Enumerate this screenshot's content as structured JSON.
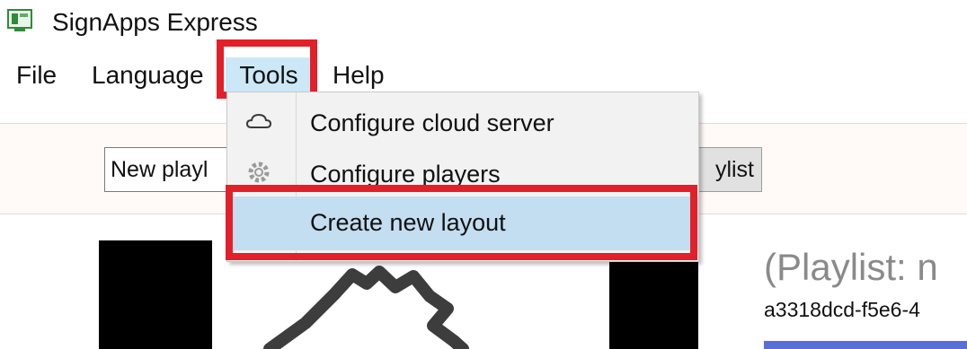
{
  "window": {
    "title": "SignApps Express",
    "icon": "signapps-app-icon"
  },
  "menubar": {
    "items": [
      {
        "label": "File"
      },
      {
        "label": "Language"
      },
      {
        "label": "Tools",
        "state": "open"
      },
      {
        "label": "Help"
      }
    ]
  },
  "tools_menu": {
    "items": [
      {
        "label": "Configure cloud server",
        "icon": "cloud-icon"
      },
      {
        "label": "Configure players",
        "icon": "gear-icon"
      },
      {
        "label": "Create new layout",
        "state": "highlighted"
      }
    ]
  },
  "toolbar": {
    "playlist_field_value": "New playl",
    "playlist_button_label": "ylist"
  },
  "main": {
    "playlist_title": "(Playlist: n",
    "playlist_id": "a3318dcd-f5e6-4"
  },
  "colors": {
    "highlight_red": "#e3202a",
    "menu_selected": "#cce8f6",
    "item_selected": "#c3def0",
    "strip_blue": "#5a6fd8"
  }
}
